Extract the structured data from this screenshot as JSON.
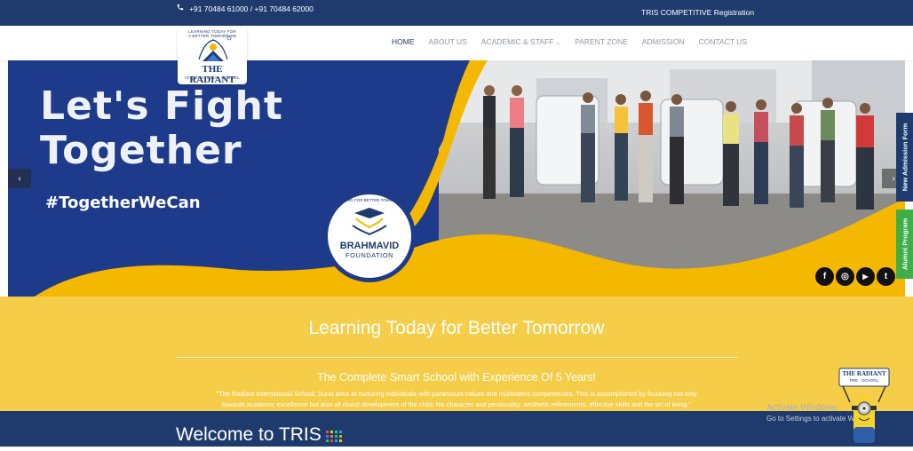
{
  "topbar": {
    "phone_icon": "phone-icon",
    "phones": "+91 70484 61000 / +91 70484 62000",
    "registration_link": "TRIS COMPETITIVE Registration"
  },
  "logo": {
    "arc_text": "LEARNING TODAY FOR A BETTER TOMORROW",
    "name": "THE RADIANT",
    "subtitle": "INTERNATIONAL SCHOOL"
  },
  "nav": {
    "items": [
      "HOME",
      "ABOUT US",
      "ACADEMIC & STAFF",
      "PARENT ZONE",
      "ADMISSION",
      "CONTACT US"
    ],
    "active": "HOME",
    "dropdown_icon": "chevron-down-icon"
  },
  "hero": {
    "headline_line1": "Let's Fight",
    "headline_line2": "Together",
    "hashtag": "#TogetherWeCan",
    "foundation_arc": "WORKING FOR BETTER TOMORROW",
    "foundation_name": "BRAHMAVID",
    "foundation_sub": "FOUNDATION",
    "prev_arrow": "‹",
    "next_arrow": "›"
  },
  "social": {
    "facebook": "f",
    "instagram": "◎",
    "youtube": "▶",
    "twitter": "t"
  },
  "side_tabs": {
    "admission": "New Admission Form",
    "alumni": "Alumni Program"
  },
  "intro": {
    "title": "Learning Today for Better Tomorrow",
    "subtitle": "The Complete Smart School with Experience Of 5 Years!",
    "line1": "\"The Radiant International School, Surat aims at nurturing individuals with paramount values and multivalent competencies. This is accomplished by focusing not only",
    "line2": "towards academic excellence but also all round development of the child, his character and personality, aesthetic refinements, effective skills and the art of living.\""
  },
  "welcome": {
    "title": "Welcome to TRIS"
  },
  "activate": {
    "line1": "Activate Windows",
    "line2": "Go to Settings to activate W"
  },
  "mascot": {
    "sign_name": "THE RADIANT",
    "sign_sub": "PRE - SCHOOL"
  },
  "colors": {
    "navy": "#1f3b6e",
    "yellow": "#f6cd49",
    "hero_blue": "#1e3a8a",
    "wave_yellow": "#f5b800",
    "admission_tab": "#1f3b6e",
    "alumni_tab": "#3fae49"
  }
}
